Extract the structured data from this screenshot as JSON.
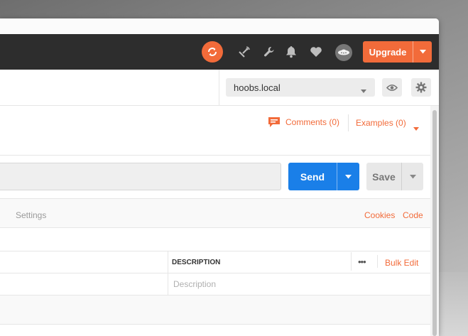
{
  "header": {
    "upgrade_label": "Upgrade",
    "icons": [
      "sync-icon",
      "satellite-icon",
      "wrench-icon",
      "bell-icon",
      "heart-icon",
      "avatar-icon"
    ]
  },
  "environment": {
    "selected": "hoobs.local",
    "icons": [
      "eye-icon",
      "gear-icon"
    ]
  },
  "request": {
    "comments_label": "Comments (0)",
    "examples_label": "Examples (0)",
    "send_label": "Send",
    "save_label": "Save"
  },
  "tabs": {
    "settings_label": "Settings",
    "cookies_label": "Cookies",
    "code_label": "Code"
  },
  "params_table": {
    "description_header": "DESCRIPTION",
    "more_label": "•••",
    "bulk_edit_label": "Bulk Edit",
    "description_placeholder": "Description"
  },
  "colors": {
    "accent": "#f26b3a",
    "send_blue": "#1a7fe8",
    "header_bg": "#2d2d2d"
  }
}
